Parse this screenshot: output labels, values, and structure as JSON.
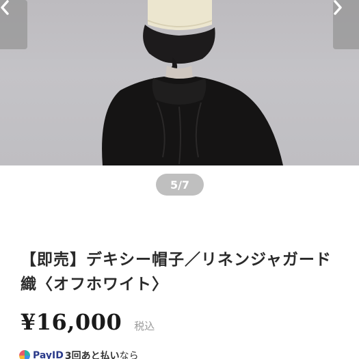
{
  "gallery": {
    "counter": "5/7",
    "prev_label": "‹",
    "next_label": "›"
  },
  "product": {
    "title": "【即売】デキシー帽子／リネンジャガード織〈オフホワイト〉",
    "price": "¥16,000",
    "tax_note": "税込"
  },
  "payment": {
    "brand": "PayID",
    "text_bold": "3回あと払い",
    "text_rest": "なら"
  },
  "colors": {
    "counter_bg": "#bfbfbf",
    "nav_bg": "#969696",
    "price": "#1a1a1a"
  }
}
